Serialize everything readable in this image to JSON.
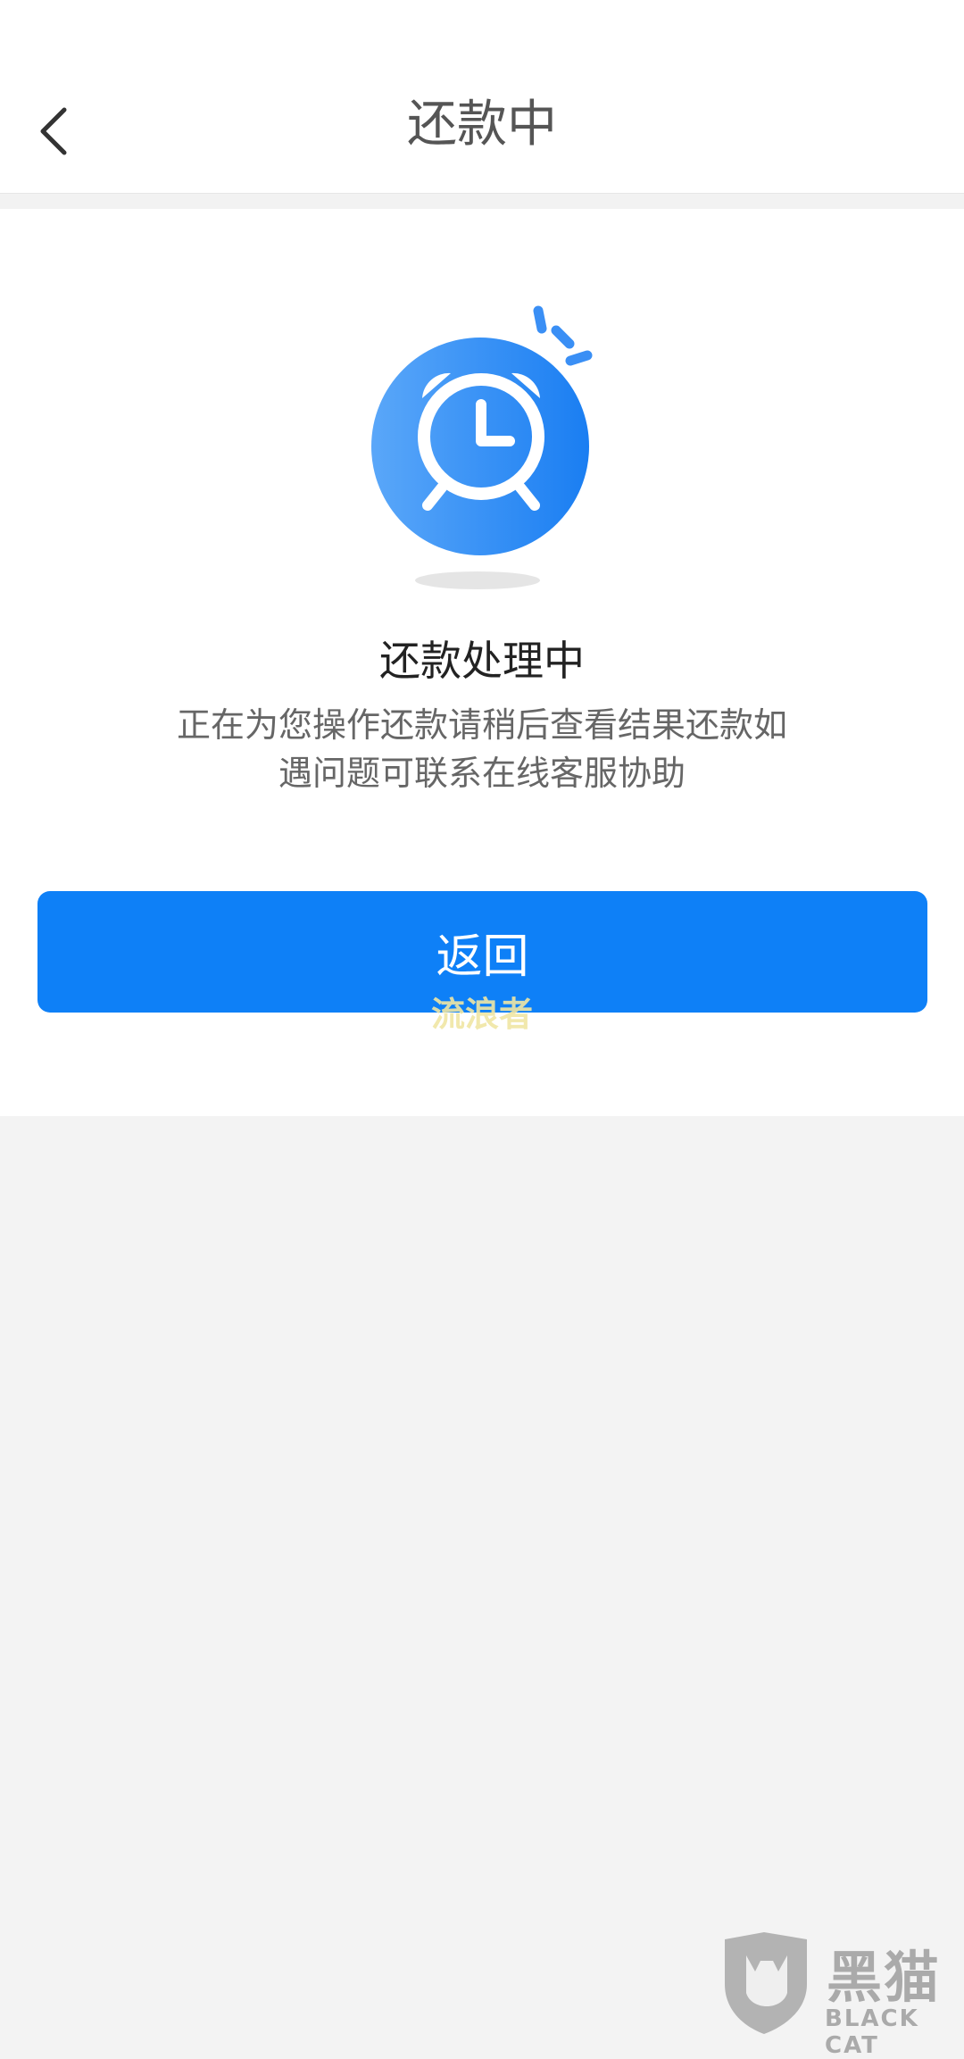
{
  "header": {
    "title": "还款中",
    "back_icon": "chevron-left-icon"
  },
  "status": {
    "icon": "alarm-clock-icon",
    "title": "还款处理中",
    "description_line1": "正在为您操作还款请稍后查看结果还款如",
    "description_line2": "遇问题可联系在线客服协助"
  },
  "actions": {
    "return_label": "返回"
  },
  "watermarks": {
    "center_text": "流浪者",
    "corner_logo_cn": "黑猫",
    "corner_logo_en": "BLACK CAT"
  },
  "colors": {
    "primary": "#0e80f7",
    "page_bg": "#f3f3f3",
    "title_text": "#555555"
  }
}
